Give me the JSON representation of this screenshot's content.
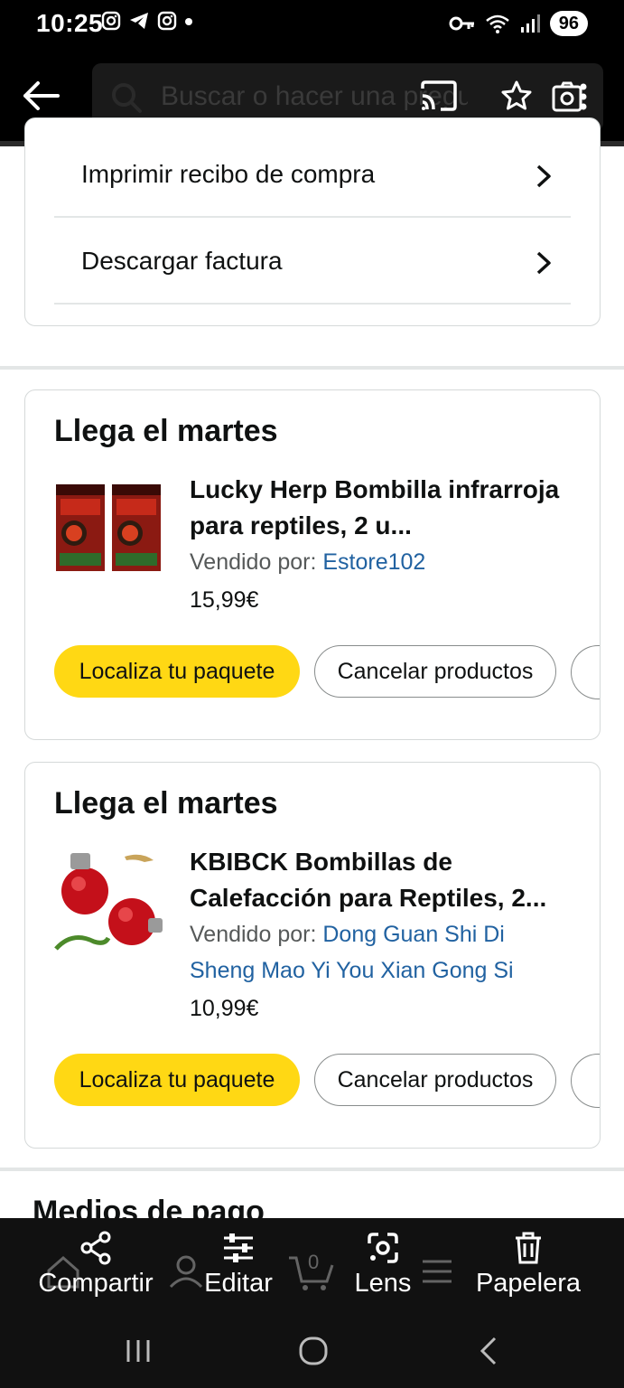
{
  "status_bar": {
    "time": "10:25",
    "battery": "96"
  },
  "search": {
    "placeholder": "Buscar o hacer una pregunta"
  },
  "actions": {
    "print_receipt": "Imprimir recibo de compra",
    "download_invoice": "Descargar factura"
  },
  "orders": [
    {
      "heading": "Llega el martes",
      "title": "Lucky Herp Bombilla infrarroja para reptiles, 2 u...",
      "seller_label": "Vendido por:",
      "seller_name": "Estore102",
      "price": "15,99€",
      "track_label": "Localiza tu paquete",
      "cancel_label": "Cancelar productos"
    },
    {
      "heading": "Llega el martes",
      "title": "KBIBCK Bombillas de Calefacción para Reptiles, 2...",
      "seller_label": "Vendido por:",
      "seller_name": "Dong Guan Shi Di Sheng Mao Yi You Xian Gong Si",
      "price": "10,99€",
      "track_label": "Localiza tu paquete",
      "cancel_label": "Cancelar productos"
    }
  ],
  "payment": {
    "title": "Medios de pago"
  },
  "toolbar": {
    "share": "Compartir",
    "edit": "Editar",
    "lens": "Lens",
    "trash": "Papelera",
    "cart_count": "0"
  },
  "colors": {
    "accent_yellow": "#ffd814",
    "link_blue": "#2162a1",
    "toolbar_bg": "#111111"
  }
}
